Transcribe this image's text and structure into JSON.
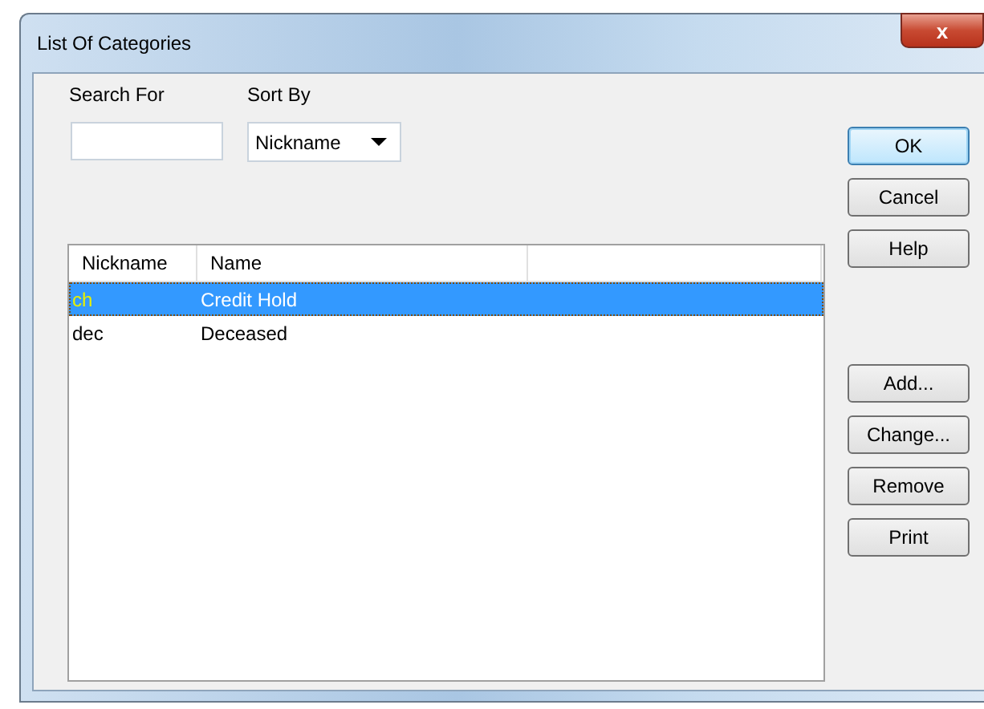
{
  "window": {
    "title": "List Of Categories",
    "close": "x"
  },
  "search": {
    "label": "Search For"
  },
  "sort": {
    "label": "Sort By",
    "value": "Nickname"
  },
  "table": {
    "columns": [
      "Nickname",
      "Name"
    ],
    "rows": [
      {
        "nickname": "ch",
        "name": "Credit Hold",
        "selected": true
      },
      {
        "nickname": "dec",
        "name": "Deceased",
        "selected": false
      }
    ]
  },
  "top_buttons": [
    {
      "label": "OK",
      "default": true
    },
    {
      "label": "Cancel",
      "default": false
    },
    {
      "label": "Help",
      "default": false
    }
  ],
  "lower_buttons": [
    {
      "label": "Add...",
      "default": false
    },
    {
      "label": "Change...",
      "default": false
    },
    {
      "label": "Remove",
      "default": false
    },
    {
      "label": "Print",
      "default": false
    }
  ]
}
